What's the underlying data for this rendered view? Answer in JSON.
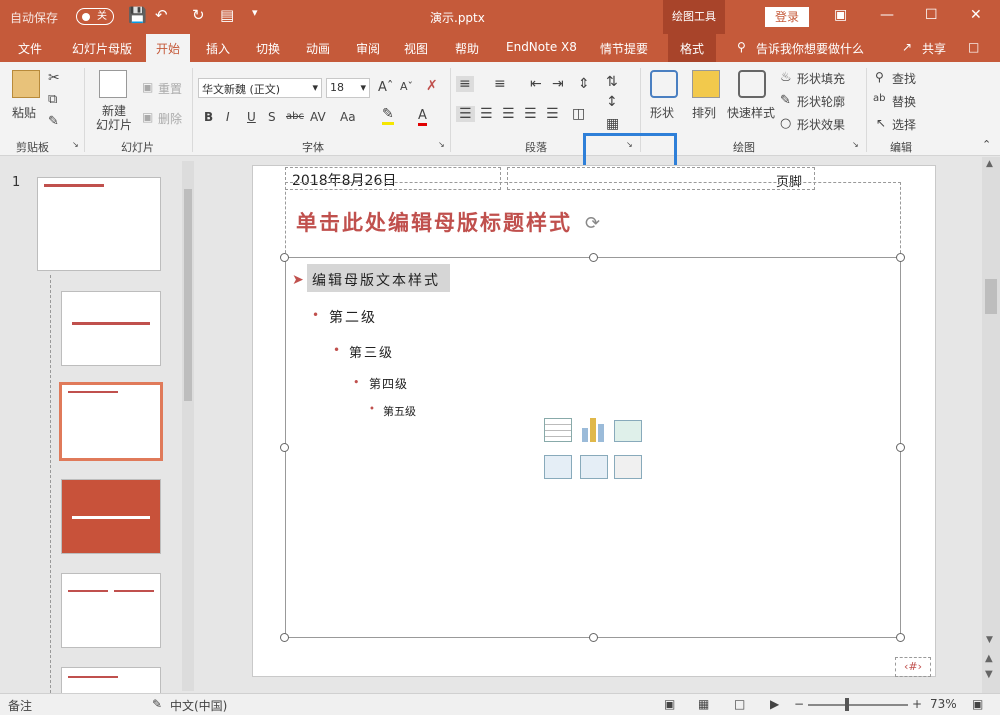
{
  "titlebar": {
    "autosave": "自动保存",
    "toggle": "关",
    "doc_title": "演示.pptx",
    "context_header": "绘图工具",
    "login": "登录"
  },
  "tabs": [
    "文件",
    "幻灯片母版",
    "开始",
    "插入",
    "切换",
    "动画",
    "审阅",
    "视图",
    "帮助",
    "EndNote X8",
    "情节提要",
    "格式"
  ],
  "search": "告诉我你想要做什么",
  "share": "共享",
  "ribbon": {
    "paste": "粘贴",
    "clipboard": "剪贴板",
    "new_slide": "新建\n幻灯片",
    "reset": "重置",
    "delete": "删除",
    "slides": "幻灯片",
    "font_name": "华文新魏 (正文)",
    "font_size": "18",
    "font": "字体",
    "paragraph": "段落",
    "shape": "形状",
    "arrange": "排列",
    "quick_style": "快速样式",
    "shape_fill": "形状填充",
    "shape_outline": "形状轮廓",
    "shape_effect": "形状效果",
    "drawing": "绘图",
    "find": "查找",
    "replace": "替换",
    "select": "选择",
    "editing": "编辑",
    "font_buttons": [
      "B",
      "I",
      "U",
      "S",
      "abc",
      "AV",
      "Aa",
      "A"
    ]
  },
  "slide_pane": {
    "first_number": "1"
  },
  "slide": {
    "date": "2018年8月26日",
    "footer": "页脚",
    "title": "单击此处编辑母版标题样式",
    "levels": [
      "编辑母版文本样式",
      "第二级",
      "第三级",
      "第四级",
      "第五级"
    ],
    "page_num": "‹#›"
  },
  "statusbar": {
    "notes": "备注",
    "language": "中文(中国)",
    "zoom": "73%"
  },
  "colors": {
    "brand": "#c55a3a",
    "title_red": "#c0504d",
    "highlight_blue": "#2e7fd8"
  }
}
